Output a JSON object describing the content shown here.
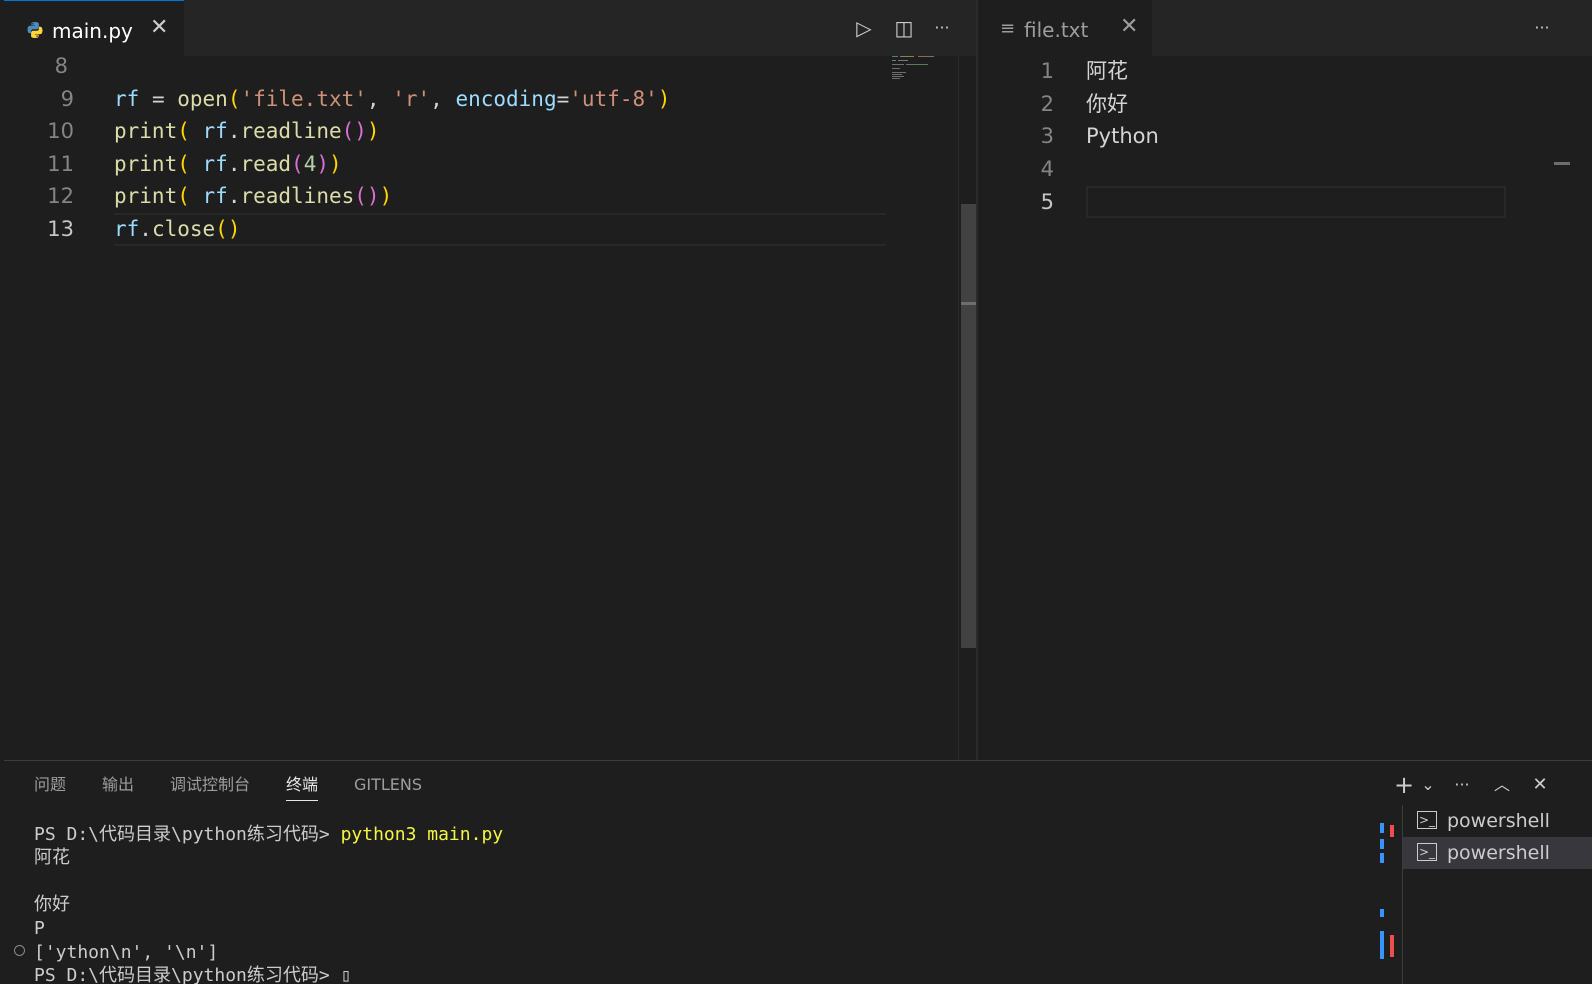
{
  "left_editor": {
    "tab": {
      "label": "main.py",
      "icon": "python-icon",
      "close_glyph": "✕"
    },
    "toolbar": {
      "run_glyph": "▷",
      "split_glyph": "◫",
      "more_glyph": "···"
    },
    "lines": [
      {
        "number": "8"
      },
      {
        "number": "9"
      },
      {
        "number": "10"
      },
      {
        "number": "11"
      },
      {
        "number": "12"
      },
      {
        "number": "13"
      }
    ],
    "code": {
      "line9": {
        "a": "rf",
        "b": " = ",
        "c": "open",
        "d": "(",
        "e": "'file.txt'",
        "f": ", ",
        "g": "'r'",
        "h": ", ",
        "i": "encoding",
        "j": "=",
        "k": "'utf-8'",
        "l": ")"
      },
      "line10": {
        "a": "print",
        "b": "(",
        "c": " rf",
        "d": ".",
        "e": "readline",
        "f": "()",
        "g": ")"
      },
      "line11": {
        "a": "print",
        "b": "(",
        "c": " rf",
        "d": ".",
        "e": "read",
        "f": "(",
        "g": "4",
        "h": ")",
        "i": ")"
      },
      "line12": {
        "a": "print",
        "b": "(",
        "c": " rf",
        "d": ".",
        "e": "readlines",
        "f": "()",
        "g": ")"
      },
      "line13": {
        "a": "rf",
        "b": ".",
        "c": "close",
        "d": "()"
      }
    }
  },
  "right_editor": {
    "tab": {
      "label": "file.txt",
      "icon": "text-file-icon",
      "icon_glyph": "≡",
      "close_glyph": "✕"
    },
    "more_glyph": "···",
    "lines": [
      {
        "number": "1",
        "text": "阿花"
      },
      {
        "number": "2",
        "text": "你好"
      },
      {
        "number": "3",
        "text": "Python"
      },
      {
        "number": "4",
        "text": ""
      },
      {
        "number": "5",
        "text": ""
      }
    ]
  },
  "panel": {
    "tabs": [
      {
        "label": "问题"
      },
      {
        "label": "输出"
      },
      {
        "label": "调试控制台"
      },
      {
        "label": "终端",
        "active": true
      },
      {
        "label": "GITLENS"
      }
    ],
    "actions": {
      "add_glyph": "+",
      "dropdown_glyph": "⌄",
      "more_glyph": "···",
      "maximize_glyph": "︿",
      "close_glyph": "✕"
    },
    "terminal": {
      "prompt": "PS D:\\代码目录\\python练习代码> ",
      "command": "python3 main.py",
      "output": [
        "阿花",
        "",
        "你好",
        "P",
        "['ython\\n', '\\n']"
      ],
      "next_prompt": "PS D:\\代码目录\\python练习代码> ▯"
    },
    "terminal_list": [
      {
        "label": "powershell",
        "selected": false
      },
      {
        "label": "powershell",
        "selected": true
      }
    ]
  },
  "colors": {
    "accent": "#0078d4",
    "editor_bg": "#1e1e1e",
    "tabbar_bg": "#252526",
    "cmd_yellow": "#f5f543"
  }
}
